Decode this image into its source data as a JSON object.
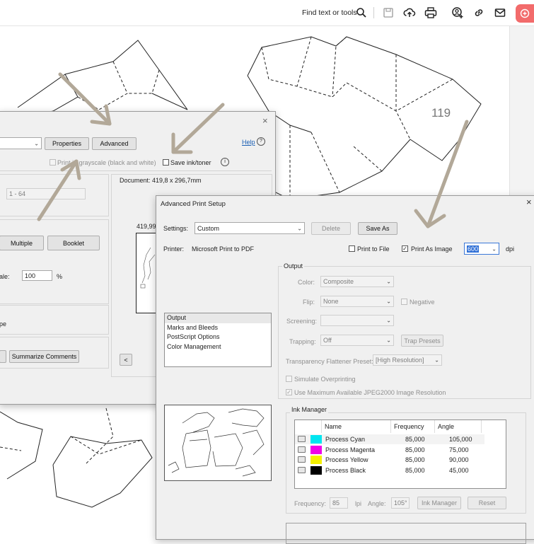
{
  "topbar": {
    "find_label": "Find text or tools",
    "icons": [
      "search-icon",
      "save-icon",
      "upload-icon",
      "print-icon",
      "add-contact-icon",
      "link-icon",
      "mail-icon",
      "share-icon"
    ]
  },
  "document": {
    "page_number": "119"
  },
  "print_dialog": {
    "properties_label": "Properties",
    "advanced_label": "Advanced",
    "help_label": "Help",
    "grayscale_label": "Print in grayscale (black and white)",
    "save_ink_label": "Save ink/toner",
    "pages_value": "1 - 64",
    "document_size": "Document: 419,8 x 296,7mm",
    "preview_size": "419,99 x",
    "multiple_label": "Multiple",
    "booklet_label": "Booklet",
    "scale_label": "ale:",
    "scale_value": "100",
    "scale_unit": "%",
    "orientation_fragment": "pe",
    "summarize_label": "Summarize Comments",
    "prev_page": "<"
  },
  "advanced_dialog": {
    "title": "Advanced Print Setup",
    "settings_label": "Settings:",
    "settings_value": "Custom",
    "delete_label": "Delete",
    "save_as_label": "Save As",
    "printer_label": "Printer:",
    "printer_value": "Microsoft Print to PDF",
    "print_to_file_label": "Print to File",
    "print_as_image_label": "Print As Image",
    "dpi_value": "600",
    "dpi_unit": "dpi",
    "sections": [
      "Output",
      "Marks and Bleeds",
      "PostScript Options",
      "Color Management"
    ],
    "output": {
      "group_label": "Output",
      "color_label": "Color:",
      "color_value": "Composite",
      "flip_label": "Flip:",
      "flip_value": "None",
      "negative_label": "Negative",
      "screening_label": "Screening:",
      "screening_value": "",
      "trapping_label": "Trapping:",
      "trapping_value": "Off",
      "trap_presets_label": "Trap Presets",
      "flattener_label": "Transparency Flattener Preset:",
      "flattener_value": "[High Resolution]",
      "simulate_label": "Simulate Overprinting",
      "jpeg2000_label": "Use Maximum Available JPEG2000 Image Resolution"
    },
    "ink_manager": {
      "group_label": "Ink Manager",
      "columns": [
        "Name",
        "Frequency",
        "Angle"
      ],
      "rows": [
        {
          "name": "Process Cyan",
          "frequency": "85,000",
          "angle": "105,000",
          "color": "#00e5f0"
        },
        {
          "name": "Process Magenta",
          "frequency": "85,000",
          "angle": "75,000",
          "color": "#f000e8"
        },
        {
          "name": "Process Yellow",
          "frequency": "85,000",
          "angle": "90,000",
          "color": "#f5f000"
        },
        {
          "name": "Process Black",
          "frequency": "85,000",
          "angle": "45,000",
          "color": "#000000"
        }
      ],
      "frequency_label": "Frequency:",
      "frequency_value": "85",
      "lpi_label": "lpi",
      "angle_label": "Angle:",
      "angle_value": "105°",
      "ink_manager_button": "Ink Manager",
      "reset_button": "Reset"
    }
  }
}
